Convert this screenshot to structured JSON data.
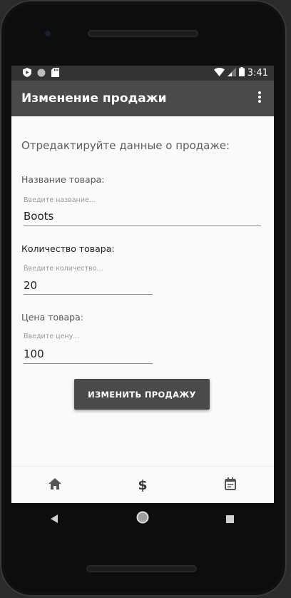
{
  "status_bar": {
    "time": "3:41",
    "icons": [
      "play-protect-icon",
      "circle-notification-icon",
      "sd-card-icon",
      "wifi-icon",
      "cell-signal-icon",
      "battery-icon"
    ]
  },
  "app_bar": {
    "title": "Изменение продажи",
    "menu_icon": "more-vert-icon"
  },
  "form": {
    "heading": "Отредактируйте данные о продаже:",
    "product_name": {
      "label": "Название товара:",
      "hint": "Введите название...",
      "value": "Boots"
    },
    "quantity": {
      "label": "Количество товара:",
      "hint": "Введите количество...",
      "value": "20"
    },
    "price": {
      "label": "Цена товара:",
      "hint": "Введите цену...",
      "value": "100"
    },
    "submit_label": "ИЗМЕНИТЬ ПРОДАЖУ"
  },
  "bottom_nav": {
    "items": [
      {
        "icon": "home-icon"
      },
      {
        "icon": "dollar-icon"
      },
      {
        "icon": "calendar-icon"
      }
    ]
  },
  "system_nav": {
    "buttons": [
      "back-icon",
      "home-circle-icon",
      "recents-icon"
    ]
  },
  "colors": {
    "app_bar": "#4a4a4a",
    "status_bar": "#333333",
    "button": "#4a4a4a",
    "background": "#fafafa"
  }
}
